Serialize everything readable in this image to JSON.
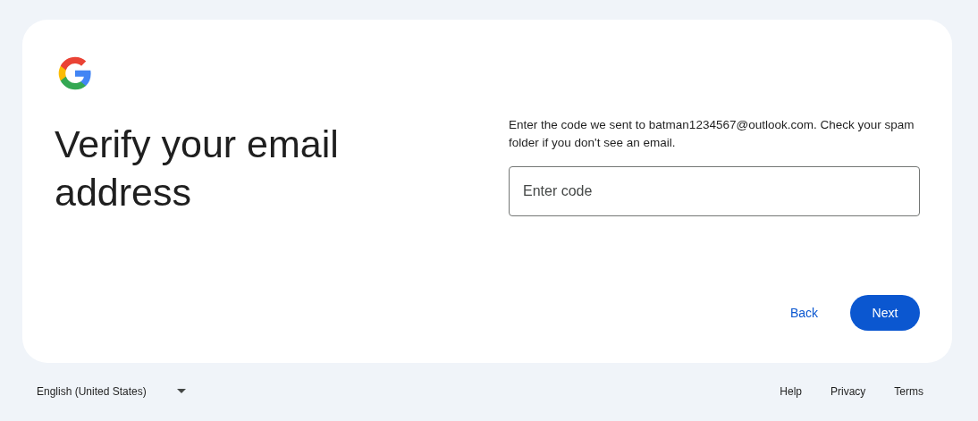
{
  "heading": "Verify your email address",
  "instructions": "Enter the code we sent to batman1234567@outlook.com. Check your spam folder if you don't see an email.",
  "code_field": {
    "placeholder": "Enter code"
  },
  "buttons": [
    {
      "label": "Back",
      "kind": "text"
    },
    {
      "label": "Next",
      "kind": "filled"
    }
  ],
  "footer": {
    "language": "English (United States)",
    "links": [
      "Help",
      "Privacy",
      "Terms"
    ]
  }
}
